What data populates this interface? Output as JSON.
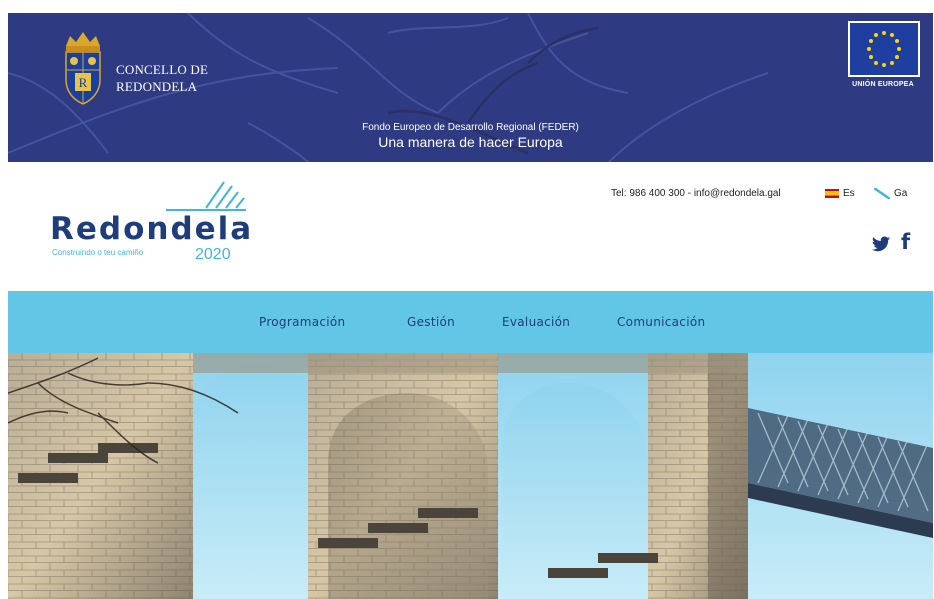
{
  "banner": {
    "council_name_line1": "CONCELLO DE",
    "council_name_line2": "REDONDELA",
    "eu_label": "UNIÓN EUROPEA",
    "feder_line1": "Fondo Europeo de Desarrollo Regional (FEDER)",
    "feder_line2": "Una manera de hacer Europa",
    "crest_letter": "R"
  },
  "header": {
    "logo_word": "Redondela",
    "logo_tagline": "Construindo o teu camiño",
    "logo_year": "2020",
    "contact": "Tel: 986 400 300 - info@redondela.gal",
    "lang_es": "Es",
    "lang_gl": "Ga",
    "facebook_glyph": "f"
  },
  "nav": {
    "items": [
      {
        "label": "Programación"
      },
      {
        "label": "Gestión"
      },
      {
        "label": "Evaluación"
      },
      {
        "label": "Comunicación"
      }
    ]
  },
  "icons": {
    "crest": "coat-of-arms-icon",
    "eu_flag": "eu-flag-icon",
    "spain_flag": "spain-flag-icon",
    "galicia_flag": "galicia-flag-icon",
    "twitter": "twitter-icon",
    "facebook": "facebook-icon"
  },
  "colors": {
    "banner_bg": "#2e3a82",
    "nav_bg": "#62c7e6",
    "brand_dark": "#1f3d7a",
    "brand_light": "#3fb6dd"
  }
}
